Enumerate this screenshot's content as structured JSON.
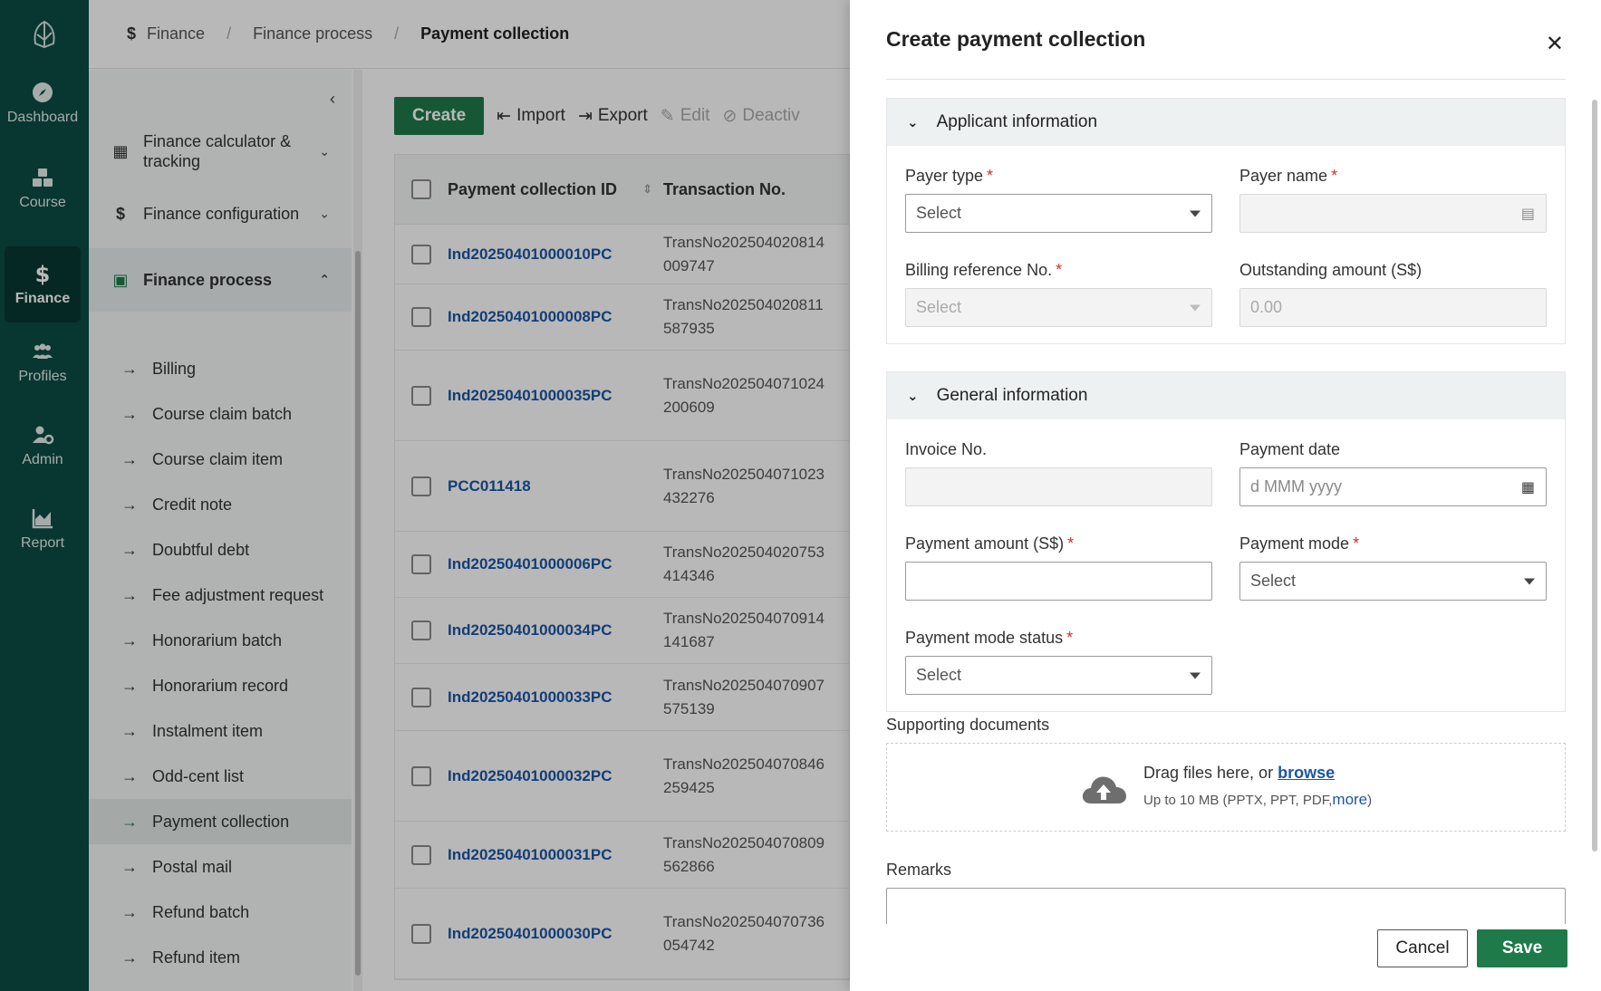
{
  "nav": {
    "items": [
      {
        "label": "Dashboard",
        "icon": "compass-icon",
        "active": false
      },
      {
        "label": "Course",
        "icon": "cubes-icon",
        "active": false
      },
      {
        "label": "Finance",
        "icon": "dollar-icon",
        "active": true
      },
      {
        "label": "Profiles",
        "icon": "users-icon",
        "active": false
      },
      {
        "label": "Admin",
        "icon": "user-gear-icon",
        "active": false
      },
      {
        "label": "Report",
        "icon": "area-chart-icon",
        "active": false
      }
    ]
  },
  "breadcrumb": [
    "Finance",
    "Finance process",
    "Payment collection"
  ],
  "sidebar": {
    "groups": [
      "Finance calculator & tracking",
      "Finance configuration",
      "Finance process"
    ],
    "items": [
      "Billing",
      "Course claim batch",
      "Course claim item",
      "Credit note",
      "Doubtful debt",
      "Fee adjustment request",
      "Honorarium batch",
      "Honorarium record",
      "Instalment item",
      "Odd-cent list",
      "Payment collection",
      "Postal mail",
      "Refund batch",
      "Refund item"
    ],
    "active_item": "Payment collection"
  },
  "toolbar": {
    "create": "Create",
    "import": "Import",
    "export": "Export",
    "edit": "Edit",
    "deactivate": "Deactiv"
  },
  "table": {
    "headers": [
      "Payment collection ID",
      "Transaction No."
    ],
    "rows": [
      {
        "id": "Ind20250401000010PC",
        "tx1": "TransNo202504020814",
        "tx2": "009747"
      },
      {
        "id": "Ind20250401000008PC",
        "tx1": "TransNo202504020811",
        "tx2": "587935"
      },
      {
        "id": "Ind20250401000035PC",
        "tx1": "TransNo202504071024",
        "tx2": "200609"
      },
      {
        "id": "PCC011418",
        "tx1": "TransNo202504071023",
        "tx2": "432276"
      },
      {
        "id": "Ind20250401000006PC",
        "tx1": "TransNo202504020753",
        "tx2": "414346"
      },
      {
        "id": "Ind20250401000034PC",
        "tx1": "TransNo202504070914",
        "tx2": "141687"
      },
      {
        "id": "Ind20250401000033PC",
        "tx1": "TransNo202504070907",
        "tx2": "575139"
      },
      {
        "id": "Ind20250401000032PC",
        "tx1": "TransNo202504070846",
        "tx2": "259425"
      },
      {
        "id": "Ind20250401000031PC",
        "tx1": "TransNo202504070809",
        "tx2": "562866"
      },
      {
        "id": "Ind20250401000030PC",
        "tx1": "TransNo202504070736",
        "tx2": "054742"
      }
    ]
  },
  "drawer": {
    "title": "Create payment collection",
    "applicant": {
      "title": "Applicant information",
      "payer_type_label": "Payer type",
      "payer_type_value": "Select",
      "payer_name_label": "Payer name",
      "payer_name_value": "",
      "billing_ref_label": "Billing reference No.",
      "billing_ref_value": "Select",
      "outstanding_label": "Outstanding amount (S$)",
      "outstanding_value": "0.00"
    },
    "general": {
      "title": "General information",
      "invoice_label": "Invoice No.",
      "invoice_value": "",
      "payment_date_label": "Payment date",
      "payment_date_placeholder": "d MMM yyyy",
      "amount_label": "Payment amount (S$)",
      "amount_value": "",
      "mode_label": "Payment mode",
      "mode_value": "Select",
      "mode_status_label": "Payment mode status",
      "mode_status_value": "Select"
    },
    "supporting_docs": {
      "label": "Supporting documents",
      "drag_text": "Drag files here, or",
      "browse": "browse",
      "limit_text": "Up to 10 MB (PPTX, PPT, PDF,",
      "more": "more",
      "close_paren": ")"
    },
    "remarks_label": "Remarks",
    "cancel": "Cancel",
    "save": "Save"
  },
  "colors": {
    "rail": "#0c4b45",
    "accent": "#1f7a4a",
    "link": "#1b56a6",
    "required": "#d0312d"
  }
}
